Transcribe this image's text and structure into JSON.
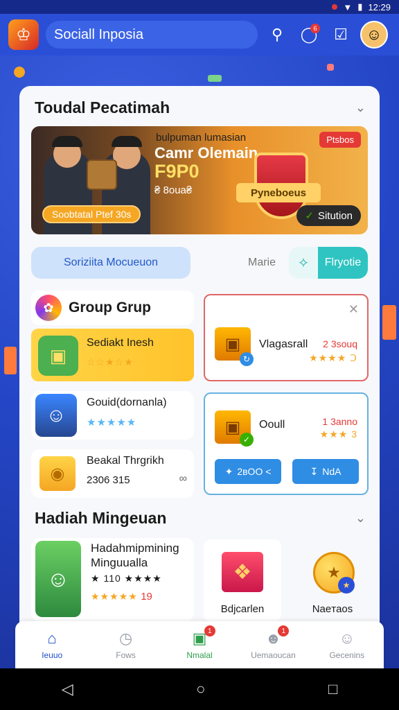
{
  "status_bar": {
    "time": "12:29"
  },
  "app_bar": {
    "title": "Sociall Inposia",
    "notif_count": "6"
  },
  "section1": {
    "title": "Toudal Pecatimah"
  },
  "banner": {
    "subtitle": "bulpuman lumasian",
    "title": "Camr Olemain",
    "big": "F9P0",
    "amount": "₴ 8oua₴",
    "tag": "Ptsbos",
    "ribbon": "Soobtatal Ptef 30s",
    "shield_label": "Pyneboeus",
    "action_label": "Sitution"
  },
  "tabs": {
    "left": "Soriziita Mocueuon",
    "mid": "Marie",
    "right": "Flryotie"
  },
  "group": {
    "title": "Group Grup",
    "item1": {
      "label": "Sediakt Inesh",
      "stars": "☆☆★☆★"
    },
    "item2": {
      "label": "Gouid(dornanla)",
      "stars": "★★★★★"
    },
    "item3": {
      "label": "Beakal Thrgrikh",
      "sub": "2306 315"
    }
  },
  "offers": {
    "red": {
      "label": "Vlagasrall",
      "price": "2 3souq",
      "stars": "★★★★ Ↄ"
    },
    "blue": {
      "label": "Ooull",
      "price": "1 3anno",
      "stars": "★★★ 3",
      "btn1": "2вOO <",
      "btn2": "NdA"
    }
  },
  "section2": {
    "title": "Hadiah Mingeuan",
    "item1": {
      "title": "Hadahmipmining Minguualla",
      "s1": "★ 110 ★★★★",
      "s2_stars": "★★★★★",
      "s2_num": "19"
    },
    "item2": {
      "label": "Bdjcarlen"
    },
    "item3": {
      "label": "Naeтaos"
    }
  },
  "bottom_nav": [
    {
      "label": "Ieuuo",
      "badge": ""
    },
    {
      "label": "Fows",
      "badge": ""
    },
    {
      "label": "Nmalal",
      "badge": "1"
    },
    {
      "label": "Uemaoucan",
      "badge": "1"
    },
    {
      "label": "Gecenins",
      "badge": ""
    }
  ],
  "colors": {
    "primary": "#2a4fd6",
    "accent": "#f5a623",
    "danger": "#e53935",
    "teal": "#2fc4c1"
  }
}
